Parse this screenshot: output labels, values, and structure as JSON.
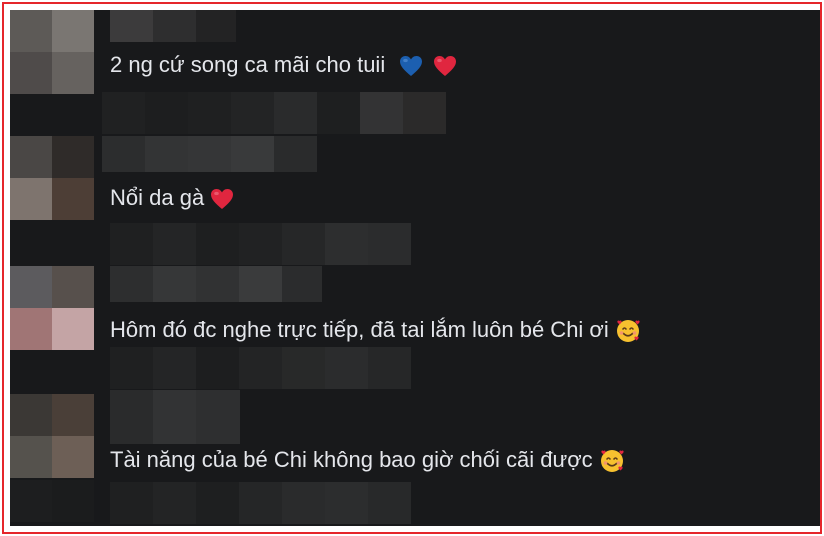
{
  "comments": [
    {
      "text": "2 ng cứ song ca mãi cho tuii",
      "emojis": [
        "blue-heart-icon",
        "red-heart-icon"
      ]
    },
    {
      "text": "Nổi da gà",
      "emojis": [
        "red-heart-icon"
      ]
    },
    {
      "text": "Hôm đó đc nghe trực tiếp, đã tai lắm luôn bé Chi ơi",
      "emojis": [
        "smiling-face-with-hearts-icon"
      ]
    },
    {
      "text": "Tài năng của bé Chi không bao giờ chối cãi được",
      "emojis": [
        "smiling-face-with-hearts-icon"
      ]
    }
  ],
  "colors": {
    "background": "#18191b",
    "text": "#e4e6eb",
    "frame": "#e5262b",
    "heart_red": "#e0263f",
    "heart_blue": "#1c5fb0"
  }
}
